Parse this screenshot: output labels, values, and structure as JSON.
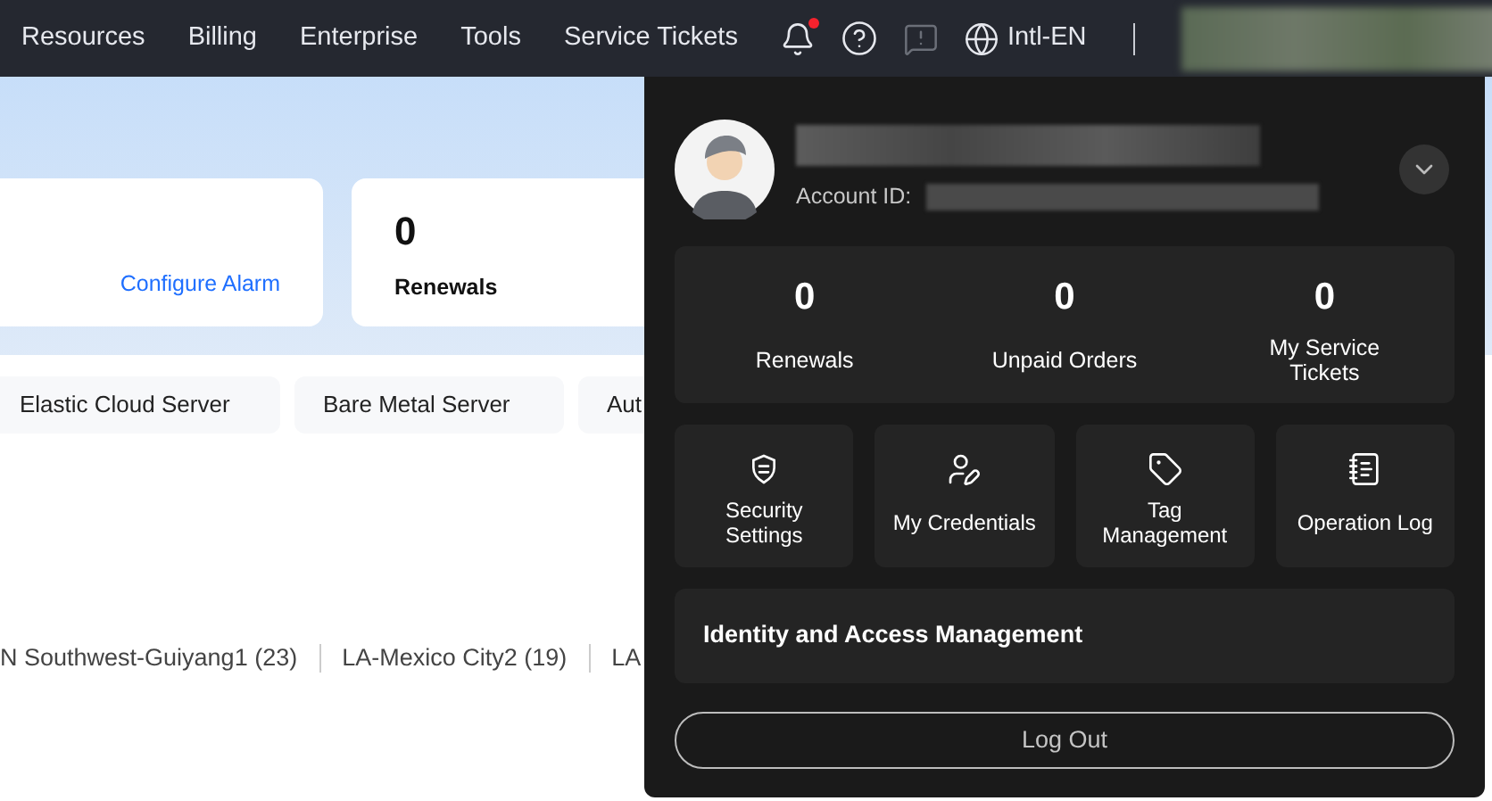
{
  "nav": {
    "items": [
      "Resources",
      "Billing",
      "Enterprise",
      "Tools",
      "Service Tickets"
    ],
    "notifications_unread": true,
    "language": "Intl-EN"
  },
  "overview": {
    "alarm_link": "Configure Alarm",
    "renewals": {
      "value": "0",
      "label": "Renewals"
    }
  },
  "quick_links": [
    "Elastic Cloud Server",
    "Bare Metal Server",
    "Aut"
  ],
  "regions": [
    "N Southwest-Guiyang1 (23)",
    "LA-Mexico City2 (19)",
    "LA"
  ],
  "account_menu": {
    "account_id_label": "Account ID:",
    "stats": [
      {
        "value": "0",
        "label": "Renewals"
      },
      {
        "value": "0",
        "label": "Unpaid Orders"
      },
      {
        "value": "0",
        "label": "My Service Tickets"
      }
    ],
    "shortcuts": [
      {
        "kind": "security",
        "label": "Security Settings"
      },
      {
        "kind": "credentials",
        "label": "My Credentials"
      },
      {
        "kind": "tag",
        "label": "Tag Management"
      },
      {
        "kind": "log",
        "label": "Operation Log"
      }
    ],
    "iam": "Identity and Access Management",
    "logout": "Log Out"
  }
}
